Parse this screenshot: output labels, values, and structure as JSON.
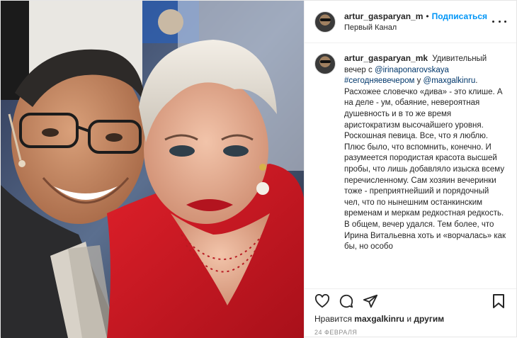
{
  "header": {
    "username": "artur_gasparyan_m",
    "separator": "•",
    "follow_label": "Подписаться",
    "location": "Первый Канал"
  },
  "caption": {
    "username": "artur_gasparyan_mk",
    "text_intro": "Удивительный вечер с",
    "mention1": "@irinaponarovskaya",
    "hashtag": "#сегодняевечером",
    "text_at": "у",
    "mention2": "@maxgalkinru",
    "text_after_mention": ".",
    "body": "Расхожее словечко «дива» - это клише. А на деле - ум, обаяние, невероятная душевность и в то же время аристократизм высочайшего уровня. Роскошная певица. Все, что я люблю. Плюс было, что вспомнить, конечно. И разумеется породистая красота высшей пробы, что лишь добавляло изыска всему перечисленному. Сам хозяин вечеринки тоже - преприятнейший и порядочный чел, что по нынешним останкинским временам и меркам редкостная редкость. В общем, вечер удался. Тем более, что Ирина Витальевна хоть и «ворчалась» как бы, но особо"
  },
  "likes": {
    "prefix": "Нравится",
    "user": "maxgalkinru",
    "and": "и",
    "others": "другим"
  },
  "date": "24 февраля",
  "icons": {
    "like": "heart-icon",
    "comment": "comment-icon",
    "share": "share-icon",
    "save": "bookmark-icon",
    "more": "more-options-icon"
  },
  "colors": {
    "link": "#00376b",
    "follow": "#0095f6",
    "border": "#efefef",
    "muted": "#8e8e8e"
  }
}
